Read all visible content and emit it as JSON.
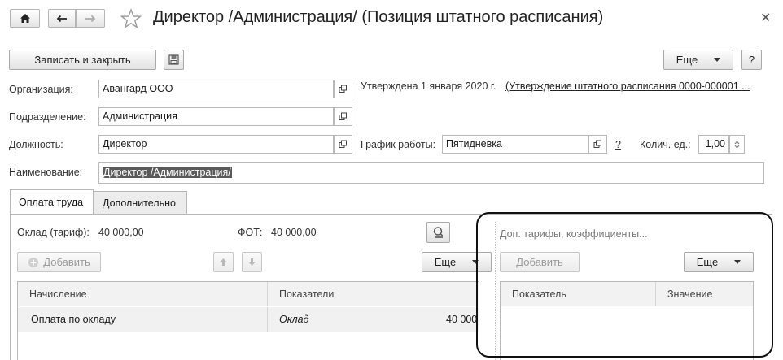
{
  "window": {
    "title": "Директор /Администрация/ (Позиция штатного расписания)"
  },
  "toolbar": {
    "save_close_label": "Записать и закрыть",
    "more_label": "Еще",
    "help_label": "?"
  },
  "form": {
    "org_label": "Организация:",
    "org_value": "Авангард ООО",
    "approved_text": "Утверждена 1 января 2020 г.",
    "approved_link": "(Утверждение штатного расписания 0000-000001 ...",
    "dept_label": "Подразделение:",
    "dept_value": "Администрация",
    "position_label": "Должность:",
    "position_value": "Директор",
    "schedule_label": "График работы:",
    "schedule_value": "Пятидневка",
    "schedule_help": "?",
    "qty_label": "Колич. ед.:",
    "qty_value": "1,00",
    "name_label": "Наименование:",
    "name_value": "Директор /Администрация/"
  },
  "tabs": [
    {
      "label": "Оплата труда",
      "active": true
    },
    {
      "label": "Дополнительно",
      "active": false
    }
  ],
  "pay": {
    "salary_label": "Оклад (тариф):",
    "salary_value": "40 000,00",
    "fot_label": "ФОТ:",
    "fot_value": "40 000,00",
    "add_label": "Добавить",
    "more_label": "Еще",
    "columns": [
      "Начисление",
      "Показатели"
    ],
    "rows": [
      {
        "accrual": "Оплата по окладу",
        "indicator": "Оклад",
        "value": "40 000"
      }
    ]
  },
  "tariffs": {
    "title": "Доп. тарифы, коэффициенты...",
    "add_label": "Добавить",
    "more_label": "Еще",
    "columns": [
      "Показатель",
      "Значение"
    ]
  },
  "colors": {
    "accent_border": "#111111",
    "selected_row": "#f1f1f1",
    "selection": "#5a5a5a"
  }
}
